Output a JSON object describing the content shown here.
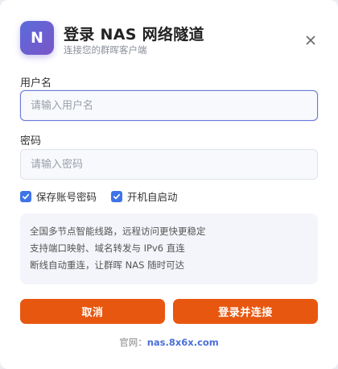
{
  "dialog": {
    "logo_letter": "N",
    "title": "登录 NAS 网络隧道",
    "subtitle": "连接您的群晖客户端"
  },
  "form": {
    "username": {
      "label": "用户名",
      "placeholder": "请输入用户名",
      "value": ""
    },
    "password": {
      "label": "密码",
      "placeholder": "请输入密码",
      "value": ""
    },
    "remember": {
      "label": "保存账号密码",
      "checked": true
    },
    "autostart": {
      "label": "开机自启动",
      "checked": true
    }
  },
  "info_lines": [
    "全国多节点智能线路，远程访问更快更稳定",
    "支持端口映射、域名转发与 IPv6 直连",
    "断线自动重连，让群晖 NAS 随时可达"
  ],
  "buttons": {
    "cancel": "取消",
    "login": "登录并连接"
  },
  "footer": {
    "prefix": "官网：",
    "link": "nas.8x6x.com"
  },
  "colors": {
    "accent": "#e8570f",
    "checkbox": "#3f74e8",
    "link": "#4b6fd8"
  }
}
